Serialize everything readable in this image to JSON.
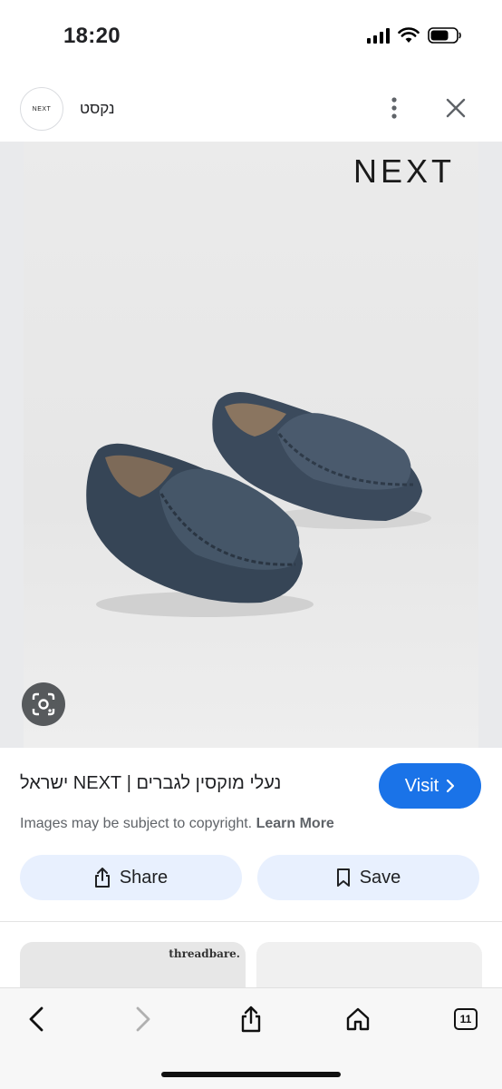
{
  "status_bar": {
    "time": "18:20",
    "icons": [
      "cellular-signal-icon",
      "wifi-icon",
      "battery-icon"
    ]
  },
  "header": {
    "logo_text": "NEXT",
    "site_name": "נקסט",
    "more_icon": "more-vert-icon",
    "close_icon": "close-icon"
  },
  "image": {
    "brand_mark": "NEXT",
    "description_icon": "lens-icon"
  },
  "result": {
    "title": "נעלי מוקסין לגברים | NEXT ישראל",
    "visit_label": "Visit",
    "copyright_text": "Images may be subject to copyright.",
    "learn_more": "Learn More"
  },
  "actions": {
    "share_label": "Share",
    "save_label": "Save"
  },
  "related": {
    "card1_label": "threadbare."
  },
  "toolbar": {
    "tab_count": "11"
  },
  "colors": {
    "accent": "#1a73e8",
    "action_bg": "#e8f0fe",
    "shoe": "#3b4a5c"
  }
}
